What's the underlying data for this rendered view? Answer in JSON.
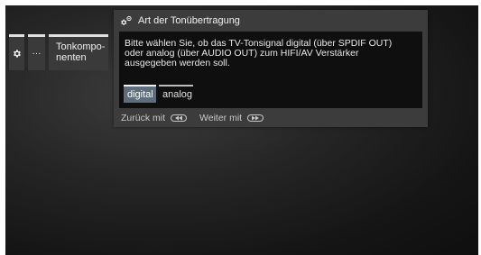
{
  "breadcrumb": {
    "gear_icon": "gear-icon",
    "dots_label": "···",
    "section_label_line1": "Tonkompo-",
    "section_label_line2": "nenten"
  },
  "dialog": {
    "icon": "settings-gears-icon",
    "title": "Art der Tonübertragung",
    "message": "Bitte wählen Sie, ob das TV-Tonsignal digital (über SPDIF OUT) oder analog (über AUDIO OUT) zum HIFI/AV Verstärker ausgegeben werden soll.",
    "options": [
      {
        "label": "digital",
        "selected": true
      },
      {
        "label": "analog",
        "selected": false
      }
    ],
    "footer": {
      "back_label": "Zurück mit",
      "back_icon": "rewind-button-icon",
      "next_label": "Weiter mit",
      "next_icon": "fast-forward-button-icon"
    }
  },
  "colors": {
    "selected_option_bg": "#5d6d7c",
    "dialog_bg": "#3c3c3c",
    "body_bg": "#0f0f0f"
  }
}
